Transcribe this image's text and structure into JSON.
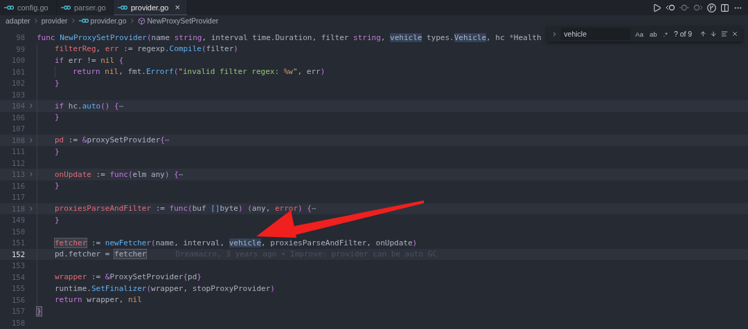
{
  "tabs": [
    {
      "label": "config.go",
      "selected": false
    },
    {
      "label": "parser.go",
      "selected": false
    },
    {
      "label": "provider.go",
      "selected": true,
      "close": "×"
    }
  ],
  "breadcrumb": [
    {
      "kind": "folder",
      "label": "adapter"
    },
    {
      "kind": "folder",
      "label": "provider"
    },
    {
      "kind": "file",
      "label": "provider.go"
    },
    {
      "kind": "symbol",
      "label": "NewProxySetProvider"
    }
  ],
  "find": {
    "value": "vehicle",
    "toggles": [
      {
        "label": "Aa",
        "on": false
      },
      {
        "label": "ab",
        "on": false
      },
      {
        "label": ".*",
        "on": false
      }
    ],
    "count": "? of 9"
  },
  "lines": [
    {
      "n": "98",
      "kind": "top",
      "folded": false,
      "current": false,
      "tokens": [
        {
          "kind": "kw",
          "t": "func "
        },
        {
          "kind": "fn",
          "t": "NewProxySetProvider"
        },
        {
          "kind": "paren",
          "t": "("
        },
        {
          "kind": "plain",
          "t": "name "
        },
        {
          "kind": "kw",
          "t": "string"
        },
        {
          "kind": "plain",
          "t": ", interval time.Duration, filter "
        },
        {
          "kind": "kw",
          "t": "string"
        },
        {
          "kind": "plain",
          "t": ", "
        },
        {
          "kind": "match",
          "t": "vehicle"
        },
        {
          "kind": "plain",
          "t": " types."
        },
        {
          "kind": "match",
          "t": "Vehicle"
        },
        {
          "kind": "plain",
          "t": ", hc "
        },
        {
          "kind": "kw",
          "t": "*"
        },
        {
          "kind": "plain",
          "t": "Health"
        }
      ]
    },
    {
      "n": "99",
      "kind": "body",
      "folded": false,
      "current": false,
      "tokens": [
        {
          "kind": "var",
          "t": "filterReg"
        },
        {
          "kind": "plain",
          "t": ", "
        },
        {
          "kind": "var",
          "t": "err"
        },
        {
          "kind": "plain",
          "t": " := regexp."
        },
        {
          "kind": "fn",
          "t": "Compile"
        },
        {
          "kind": "paren",
          "t": "("
        },
        {
          "kind": "plain",
          "t": "filter"
        },
        {
          "kind": "paren",
          "t": ")"
        }
      ]
    },
    {
      "n": "100",
      "kind": "body",
      "folded": false,
      "current": false,
      "tokens": [
        {
          "kind": "kw",
          "t": "if"
        },
        {
          "kind": "plain",
          "t": " err != "
        },
        {
          "kind": "const",
          "t": "nil"
        },
        {
          "kind": "brace",
          "t": " {"
        }
      ]
    },
    {
      "n": "101",
      "kind": "nested",
      "folded": false,
      "current": false,
      "tokens": [
        {
          "kind": "kw",
          "t": "return"
        },
        {
          "kind": "const",
          "t": " nil"
        },
        {
          "kind": "plain",
          "t": ", fmt."
        },
        {
          "kind": "fn",
          "t": "Errorf"
        },
        {
          "kind": "paren",
          "t": "("
        },
        {
          "kind": "str",
          "t": "\"invalid filter regex: "
        },
        {
          "kind": "const",
          "t": "%w"
        },
        {
          "kind": "str",
          "t": "\""
        },
        {
          "kind": "plain",
          "t": ", err"
        },
        {
          "kind": "paren",
          "t": ")"
        }
      ]
    },
    {
      "n": "102",
      "kind": "body",
      "folded": false,
      "current": false,
      "tokens": [
        {
          "kind": "brace",
          "t": "}"
        }
      ]
    },
    {
      "n": "103",
      "kind": "body",
      "folded": false,
      "current": false
    },
    {
      "n": "104",
      "kind": "body",
      "folded": true,
      "current": false,
      "tokens": [
        {
          "kind": "kw",
          "t": "if"
        },
        {
          "kind": "plain",
          "t": " hc."
        },
        {
          "kind": "fn",
          "t": "auto"
        },
        {
          "kind": "paren",
          "t": "()"
        },
        {
          "kind": "brace",
          "t": " {"
        },
        {
          "kind": "fold",
          "t": "⋯"
        }
      ]
    },
    {
      "n": "106",
      "kind": "body",
      "folded": false,
      "current": false,
      "tokens": [
        {
          "kind": "brace",
          "t": "}"
        }
      ]
    },
    {
      "n": "107",
      "kind": "body",
      "folded": false,
      "current": false
    },
    {
      "n": "108",
      "kind": "body",
      "folded": true,
      "current": false,
      "tokens": [
        {
          "kind": "var",
          "t": "pd"
        },
        {
          "kind": "plain",
          "t": " := "
        },
        {
          "kind": "kw",
          "t": "&"
        },
        {
          "kind": "plain",
          "t": "proxySetProvider"
        },
        {
          "kind": "brace",
          "t": "{"
        },
        {
          "kind": "fold",
          "t": "⋯"
        }
      ]
    },
    {
      "n": "111",
      "kind": "body",
      "folded": false,
      "current": false,
      "tokens": [
        {
          "kind": "brace",
          "t": "}"
        }
      ]
    },
    {
      "n": "112",
      "kind": "body",
      "folded": false,
      "current": false
    },
    {
      "n": "113",
      "kind": "body",
      "folded": true,
      "current": false,
      "tokens": [
        {
          "kind": "var",
          "t": "onUpdate"
        },
        {
          "kind": "plain",
          "t": " := "
        },
        {
          "kind": "kw",
          "t": "func"
        },
        {
          "kind": "paren",
          "t": "("
        },
        {
          "kind": "plain",
          "t": "elm any"
        },
        {
          "kind": "paren",
          "t": ")"
        },
        {
          "kind": "brace",
          "t": " {"
        },
        {
          "kind": "fold",
          "t": "⋯"
        }
      ]
    },
    {
      "n": "116",
      "kind": "body",
      "folded": false,
      "current": false,
      "tokens": [
        {
          "kind": "brace",
          "t": "}"
        }
      ]
    },
    {
      "n": "117",
      "kind": "body",
      "folded": false,
      "current": false
    },
    {
      "n": "118",
      "kind": "body",
      "folded": true,
      "current": false,
      "tokens": [
        {
          "kind": "var",
          "t": "proxiesParseAndFilter"
        },
        {
          "kind": "plain",
          "t": " := "
        },
        {
          "kind": "kw",
          "t": "func"
        },
        {
          "kind": "paren",
          "t": "("
        },
        {
          "kind": "plain",
          "t": "buf "
        },
        {
          "kind": "fn",
          "t": "[]"
        },
        {
          "kind": "plain",
          "t": "byte"
        },
        {
          "kind": "paren",
          "t": ") ("
        },
        {
          "kind": "plain",
          "t": "any, "
        },
        {
          "kind": "var",
          "t": "error"
        },
        {
          "kind": "paren",
          "t": ")"
        },
        {
          "kind": "brace",
          "t": " {"
        },
        {
          "kind": "fold",
          "t": "⋯"
        }
      ]
    },
    {
      "n": "149",
      "kind": "body",
      "folded": false,
      "current": false,
      "tokens": [
        {
          "kind": "brace",
          "t": "}"
        }
      ]
    },
    {
      "n": "150",
      "kind": "body",
      "folded": false,
      "current": false
    },
    {
      "n": "151",
      "kind": "body",
      "folded": false,
      "current": false,
      "tokens": [
        {
          "kind": "wordvar",
          "t": "fetcher"
        },
        {
          "kind": "plain",
          "t": " := "
        },
        {
          "kind": "fn",
          "t": "newFetcher"
        },
        {
          "kind": "paren",
          "t": "("
        },
        {
          "kind": "plain",
          "t": "name, interval, "
        },
        {
          "kind": "match",
          "t": "vehicle"
        },
        {
          "kind": "plain",
          "t": ", proxiesParseAndFilter, onUpdate"
        },
        {
          "kind": "paren",
          "t": ")"
        }
      ]
    },
    {
      "n": "152",
      "kind": "body",
      "folded": false,
      "current": true,
      "tokens": [
        {
          "kind": "plain",
          "t": "pd.fetcher = "
        },
        {
          "kind": "word",
          "t": "fetcher"
        }
      ],
      "blame": "Dreamacro, 3 years ago • Improve: provider can be auto GC"
    },
    {
      "n": "153",
      "kind": "body",
      "folded": false,
      "current": false
    },
    {
      "n": "154",
      "kind": "body",
      "folded": false,
      "current": false,
      "tokens": [
        {
          "kind": "var",
          "t": "wrapper"
        },
        {
          "kind": "plain",
          "t": " := "
        },
        {
          "kind": "kw",
          "t": "&"
        },
        {
          "kind": "plain",
          "t": "ProxySetProvider"
        },
        {
          "kind": "brace",
          "t": "{"
        },
        {
          "kind": "plain",
          "t": "pd"
        },
        {
          "kind": "brace",
          "t": "}"
        }
      ]
    },
    {
      "n": "155",
      "kind": "body",
      "folded": false,
      "current": false,
      "tokens": [
        {
          "kind": "plain",
          "t": "runtime."
        },
        {
          "kind": "fn",
          "t": "SetFinalizer"
        },
        {
          "kind": "paren",
          "t": "("
        },
        {
          "kind": "plain",
          "t": "wrapper, stopProxyProvider"
        },
        {
          "kind": "paren",
          "t": ")"
        }
      ]
    },
    {
      "n": "156",
      "kind": "body",
      "folded": false,
      "current": false,
      "tokens": [
        {
          "kind": "kw",
          "t": "return"
        },
        {
          "kind": "plain",
          "t": " wrapper, "
        },
        {
          "kind": "const",
          "t": "nil"
        }
      ]
    },
    {
      "n": "157",
      "kind": "top",
      "folded": false,
      "current": false,
      "tokens": [
        {
          "kind": "matchbrace",
          "t": "}"
        }
      ]
    },
    {
      "n": "158",
      "kind": "top",
      "folded": false,
      "current": false
    }
  ]
}
